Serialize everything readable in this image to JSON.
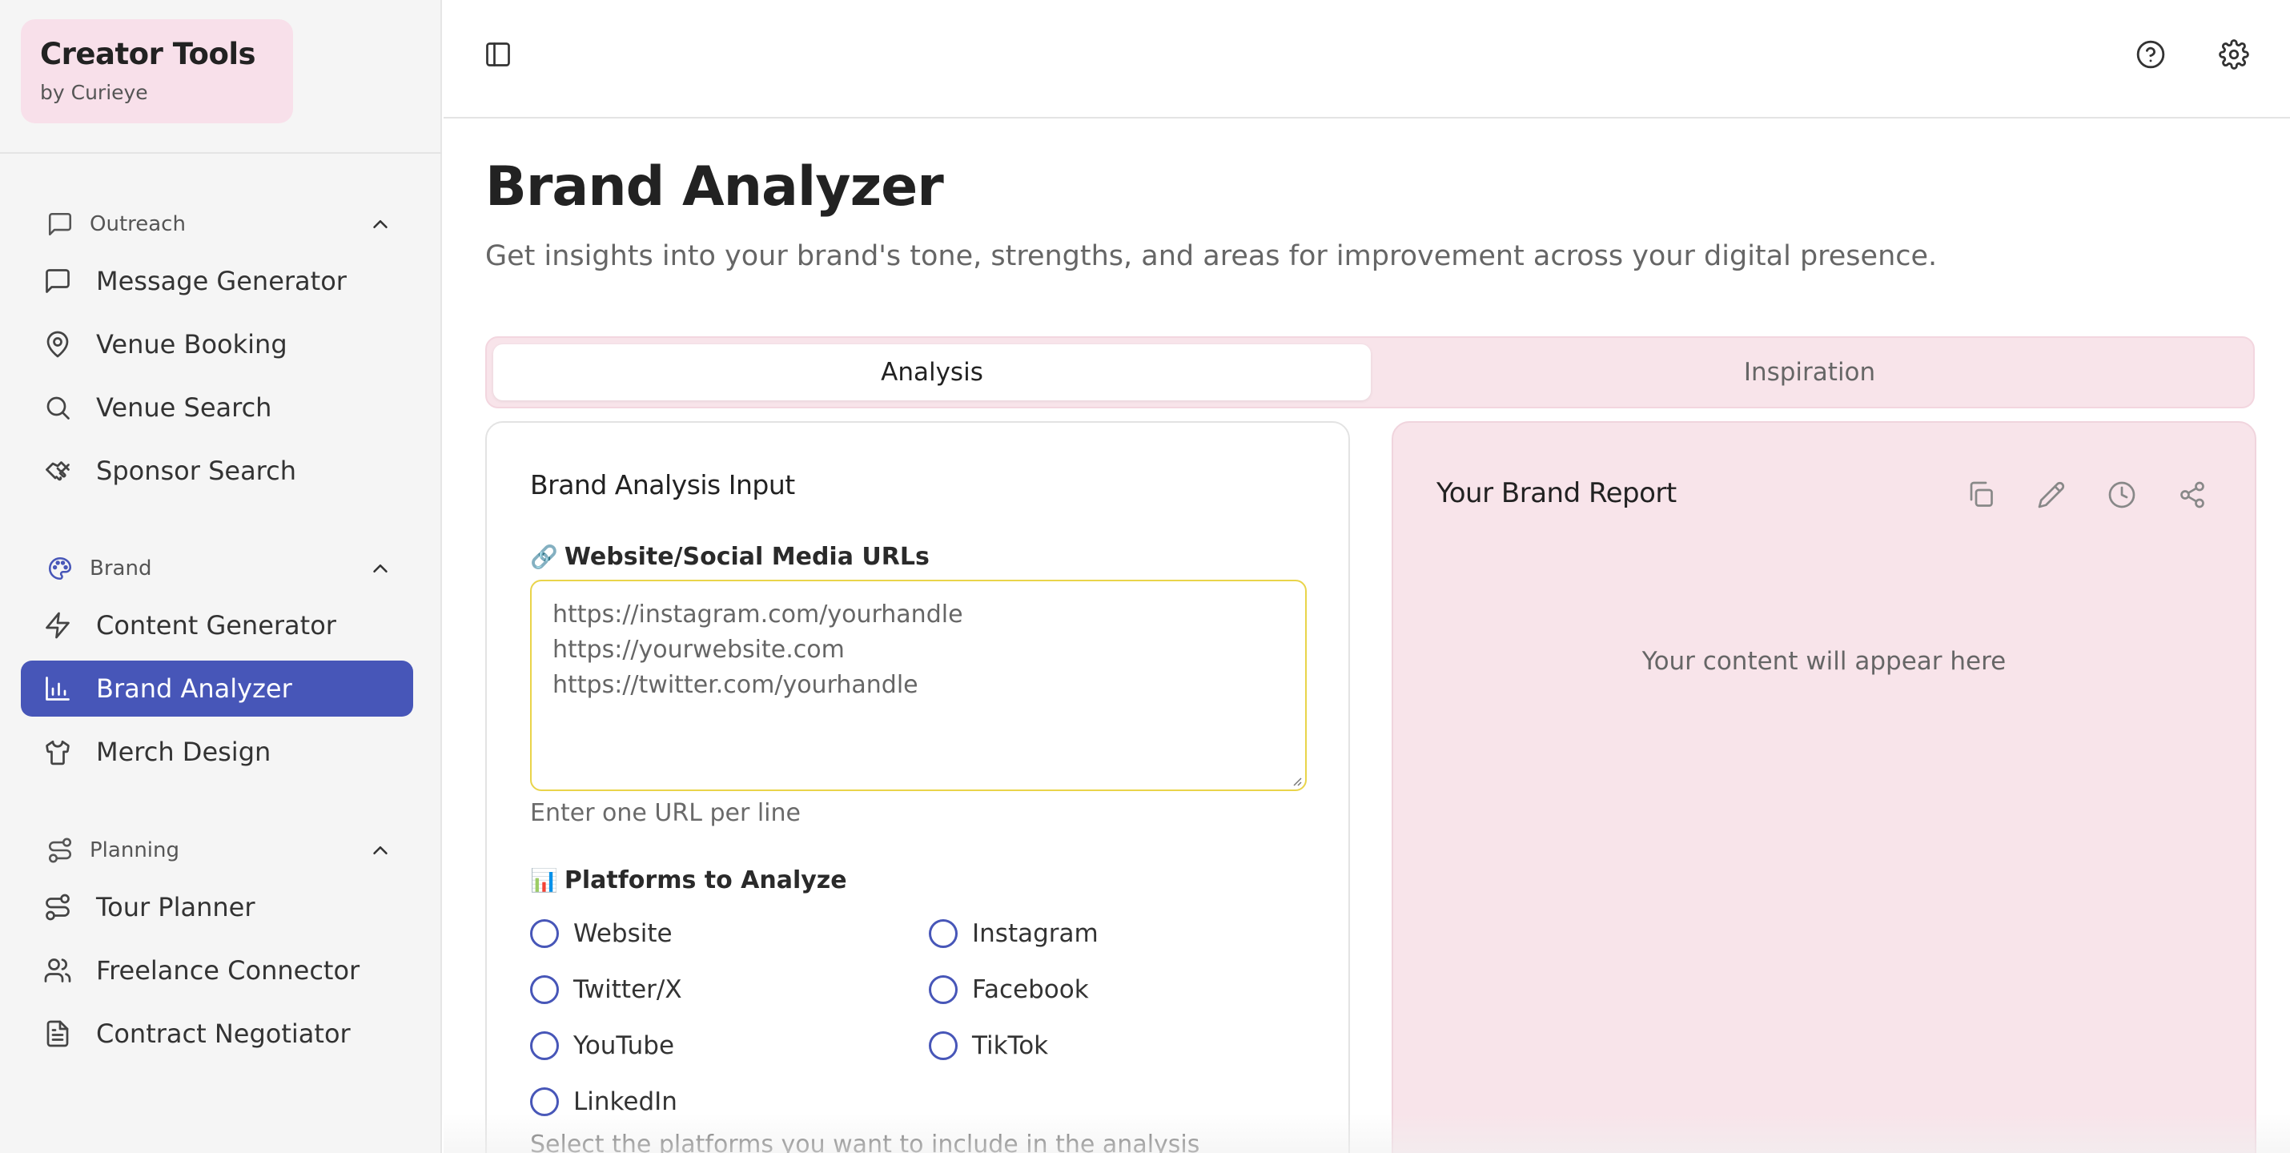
{
  "brand": {
    "title": "Creator Tools",
    "subtitle": "by Curieye"
  },
  "sidebar": {
    "sections": [
      {
        "label": "Outreach",
        "icon": "message-square-icon",
        "items": [
          {
            "label": "Message Generator",
            "icon": "message-square-icon"
          },
          {
            "label": "Venue Booking",
            "icon": "map-pin-icon"
          },
          {
            "label": "Venue Search",
            "icon": "search-icon"
          },
          {
            "label": "Sponsor Search",
            "icon": "handshake-icon"
          }
        ]
      },
      {
        "label": "Brand",
        "icon": "palette-icon",
        "items": [
          {
            "label": "Content Generator",
            "icon": "zap-icon"
          },
          {
            "label": "Brand Analyzer",
            "icon": "bar-chart-icon",
            "active": true
          },
          {
            "label": "Merch Design",
            "icon": "shirt-icon"
          }
        ]
      },
      {
        "label": "Planning",
        "icon": "route-icon",
        "items": [
          {
            "label": "Tour Planner",
            "icon": "route-icon"
          },
          {
            "label": "Freelance Connector",
            "icon": "users-icon"
          },
          {
            "label": "Contract Negotiator",
            "icon": "file-text-icon"
          }
        ]
      }
    ]
  },
  "page": {
    "title": "Brand Analyzer",
    "subtitle": "Get insights into your brand's tone, strengths, and areas for improvement across your digital presence."
  },
  "tabs": [
    {
      "label": "Analysis",
      "active": true
    },
    {
      "label": "Inspiration",
      "active": false
    }
  ],
  "input_card": {
    "title": "Brand Analysis Input",
    "urls_label": "Website/Social Media URLs",
    "urls_emoji": "🔗",
    "urls_placeholder": "https://instagram.com/yourhandle\nhttps://yourwebsite.com\nhttps://twitter.com/yourhandle",
    "urls_hint": "Enter one URL per line",
    "platforms_label": "Platforms to Analyze",
    "platforms_emoji": "📊",
    "platforms": [
      "Website",
      "Instagram",
      "Twitter/X",
      "Facebook",
      "YouTube",
      "TikTok",
      "LinkedIn"
    ],
    "platforms_hint": "Select the platforms you want to include in the analysis"
  },
  "report_card": {
    "title": "Your Brand Report",
    "placeholder": "Your content will appear here",
    "tools": [
      "copy-icon",
      "edit-pencil-icon",
      "history-clock-icon",
      "share-icon"
    ]
  },
  "colors": {
    "accent": "#4756b8",
    "pink_bg": "#f8e4ea",
    "input_border": "#e9d44a"
  }
}
